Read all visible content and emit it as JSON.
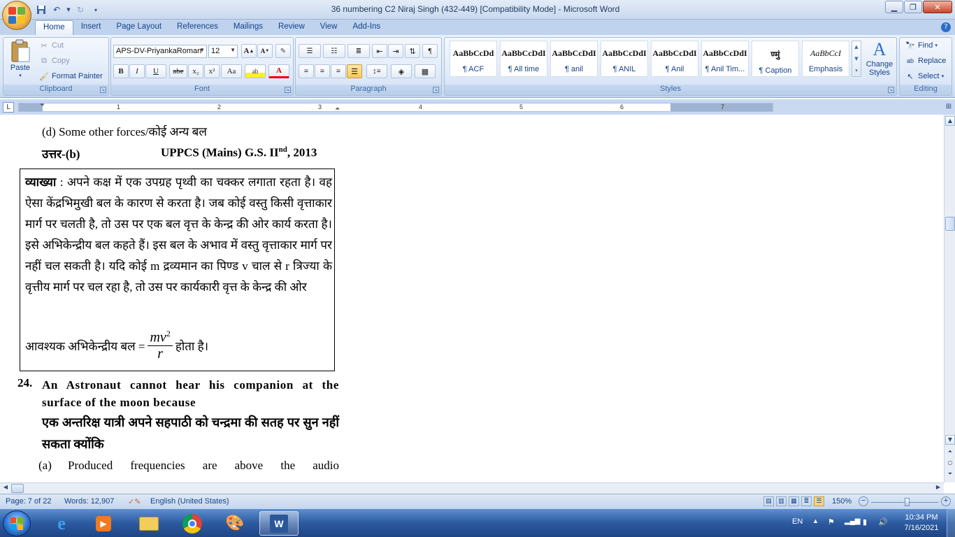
{
  "window": {
    "title": "36 numbering C2 Niraj Singh (432-449) [Compatibility Mode] - Microsoft Word"
  },
  "ribbon_tabs": [
    "Home",
    "Insert",
    "Page Layout",
    "References",
    "Mailings",
    "Review",
    "View",
    "Add-Ins"
  ],
  "clipboard": {
    "paste": "Paste",
    "cut": "Cut",
    "copy": "Copy",
    "format_painter": "Format Painter",
    "label": "Clipboard"
  },
  "font": {
    "family": "APS-DV-PriyankaRoman",
    "size": "12",
    "grow": "A",
    "shrink": "A",
    "bold": "B",
    "italic": "I",
    "underline": "U",
    "strike": "abe",
    "subscript": "x₂",
    "superscript": "x²",
    "change_case": "Aa",
    "font_color": "A",
    "label": "Font"
  },
  "paragraph": {
    "label": "Paragraph"
  },
  "styles": {
    "label": "Styles",
    "gallery": [
      {
        "preview": "AaBbCcDd",
        "name": "¶ ACF"
      },
      {
        "preview": "AaBbCcDdI",
        "name": "¶ All time"
      },
      {
        "preview": "AaBbCcDdI",
        "name": "¶ anil"
      },
      {
        "preview": "AaBbCcDdI",
        "name": "¶ ANIL"
      },
      {
        "preview": "AaBbCcDdI",
        "name": "¶ Anil"
      },
      {
        "preview": "AaBbCcDdI",
        "name": "¶ Anil Tim..."
      },
      {
        "preview": "ण्मुं",
        "name": "¶ Caption"
      },
      {
        "preview": "AaBbCcI",
        "name": "Emphasis"
      }
    ],
    "change_styles": "Change Styles"
  },
  "editing": {
    "find": "Find",
    "replace": "Replace",
    "select": "Select",
    "label": "Editing"
  },
  "ruler_numbers": [
    "1",
    "2",
    "3",
    "4",
    "5",
    "6",
    "7"
  ],
  "document": {
    "option_d": "(d)  Some other forces/कोई अन्य बल",
    "answer_label": "उत्तर-",
    "answer_value": "(b)",
    "source": "UPPCS (Mains) G.S. II",
    "source_sup": "nd",
    "source_year": ", 2013",
    "explanation_label": "व्याख्या",
    "explanation_body": " : अपने कक्ष में एक उपग्रह पृथ्वी का चक्कर लगाता रहता है। वह ऐसा केंद्रभिमुखी बल के कारण से करता है। जब कोई वस्तु किसी वृत्ताकार मार्ग पर चलती है, तो उस पर एक बल वृत्त के केन्द्र की ओर कार्य करता है। इसे अभिकेन्द्रीय बल कहते हैं। इस बल के अभाव में वस्तु वृत्ताकार मार्ग पर नहीं चल सकती है। यदि कोई m द्रव्यमान का पिण्ड v चाल से r त्रिज्या के वृत्तीय मार्ग पर चल रहा है, तो उस पर कार्यकारी वृत्त के केन्द्र की ओर",
    "formula_prefix": "आवश्यक अभिकेन्द्रीय बल = ",
    "formula_num": "mv",
    "formula_exp": "2",
    "formula_den": "r",
    "formula_suffix": " होता है।",
    "q_number": "24.",
    "q_text_en": "An Astronaut cannot hear his companion at the surface of the moon because",
    "q_text_hi": "एक अन्तरिक्ष यात्री अपने सहपाठी को चन्द्रमा की सतह पर सुन नहीं सकता क्योंकि",
    "option_a_label": "(a)",
    "option_a_text": "Produced frequencies are above the audio"
  },
  "status": {
    "page": "Page: 7 of 22",
    "words": "Words: 12,907",
    "language": "English (United States)",
    "zoom": "150%"
  },
  "taskbar": {
    "lang": "EN",
    "time": "10:34 PM",
    "date": "7/16/2021"
  },
  "colors": {
    "ribbon_text": "#15428b",
    "word_blue": "#2b579a"
  }
}
